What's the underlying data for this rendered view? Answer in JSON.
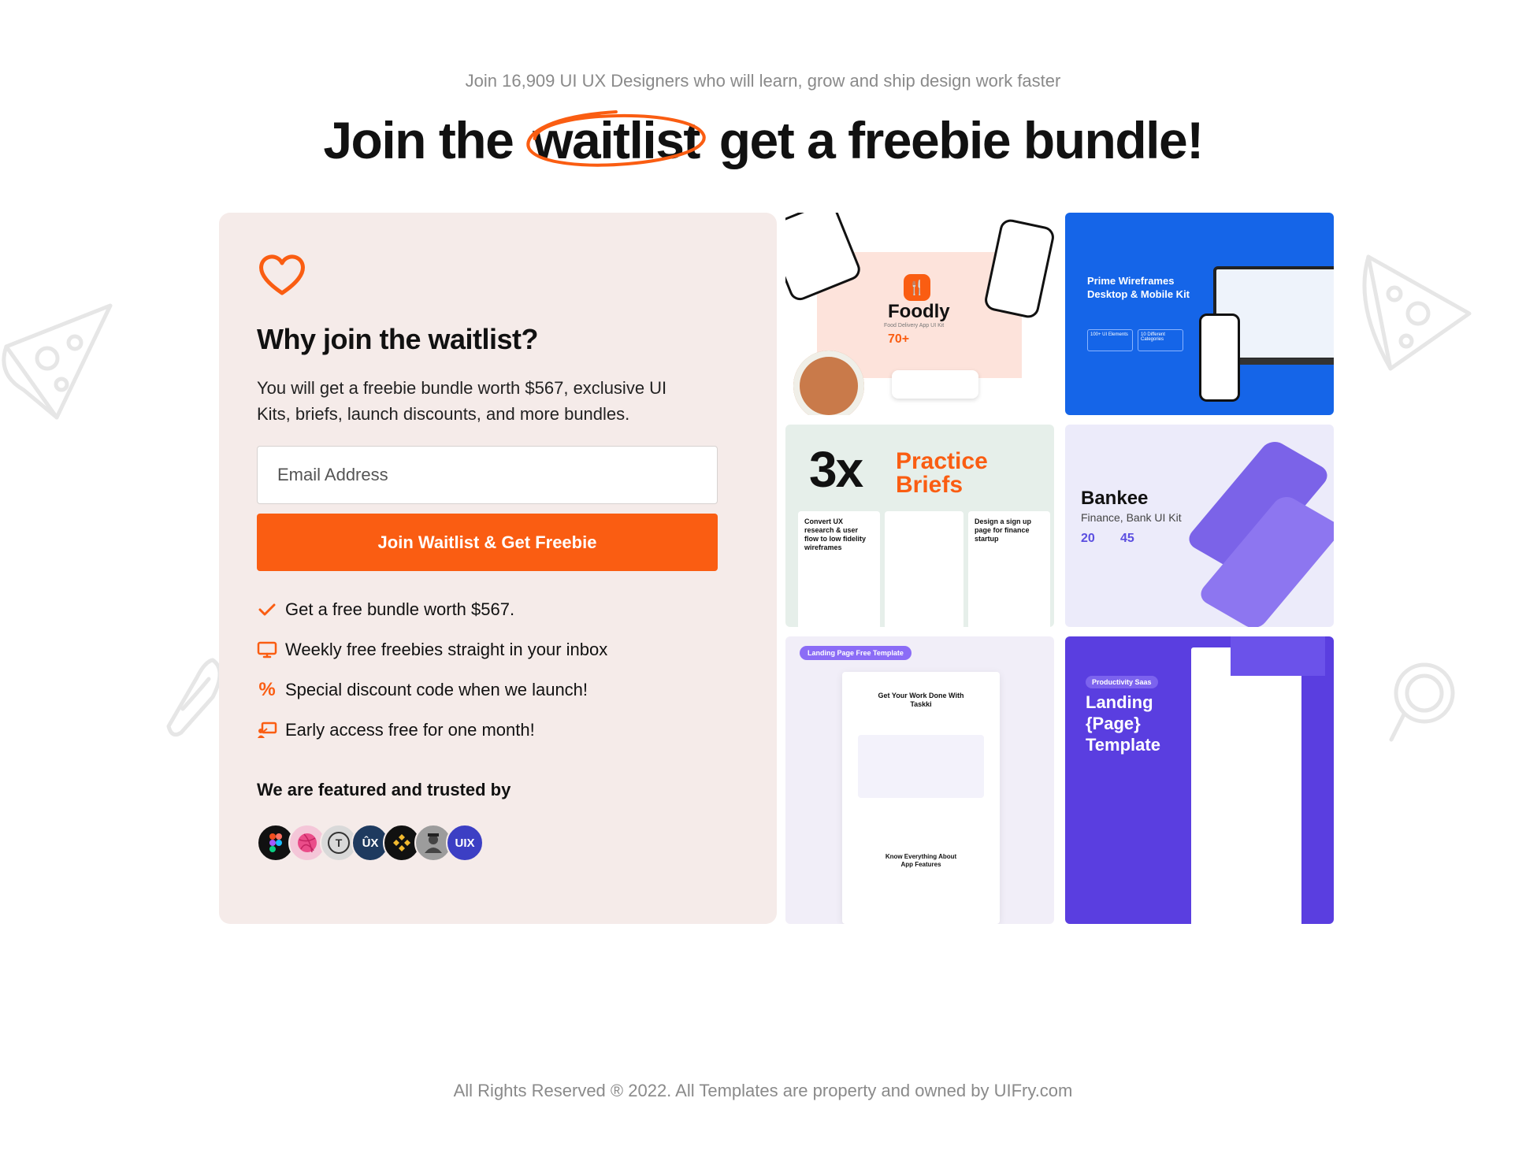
{
  "header": {
    "subtitle": "Join 16,909 UI UX Designers who will learn, grow and ship design work faster",
    "title_before": "Join the",
    "title_circled": "waitlist",
    "title_after": "get a freebie bundle!"
  },
  "card": {
    "title": "Why join the waitlist?",
    "description": "You will get a freebie bundle worth $567, exclusive UI Kits, briefs, launch discounts, and more bundles.",
    "email_placeholder": "Email Address",
    "cta_label": "Join Waitlist & Get Freebie",
    "benefits": [
      {
        "icon": "check-icon",
        "label": "Get a free bundle worth $567."
      },
      {
        "icon": "monitor-icon",
        "label": "Weekly free freebies straight in your inbox"
      },
      {
        "icon": "percent-icon",
        "label": "Special discount code when we launch!"
      },
      {
        "icon": "presentation-icon",
        "label": "Early access free for one month!"
      }
    ],
    "featured_label": "We are featured and trusted by",
    "featured_logos": [
      {
        "name": "figma-logo",
        "text": ""
      },
      {
        "name": "dribbble-logo",
        "text": ""
      },
      {
        "name": "t-logo",
        "text": "T"
      },
      {
        "name": "ux-logo",
        "text": "ÛX"
      },
      {
        "name": "binance-style-logo",
        "text": ""
      },
      {
        "name": "person-avatar-logo",
        "text": ""
      },
      {
        "name": "uix-logo",
        "text": "UIX"
      }
    ]
  },
  "gallery": {
    "foodly": {
      "title": "Foodly",
      "subtitle": "Food Delivery App UI Kit",
      "badge": "70+"
    },
    "wireframes": {
      "title": "Prime Wireframes Desktop & Mobile Kit",
      "stat1": "100+ UI Elements",
      "stat2": "10 Different Categories"
    },
    "briefs": {
      "big": "3x",
      "title_line1": "Practice",
      "title_line2": "Briefs",
      "brief1": "Convert UX research & user flow to low fidelity wireframes",
      "brief2": "Design a sign up page for finance startup"
    },
    "bankee": {
      "title": "Bankee",
      "subtitle": "Finance, Bank UI Kit",
      "stat1": "20",
      "stat2": "45"
    },
    "taskki": {
      "badge": "Landing Page Free Template",
      "headline": "Get Your Work Done With Taskki",
      "sub": "Know Everything About App Features"
    },
    "landing": {
      "badge": "Productivity Saas",
      "title": "Landing {Page} Template"
    }
  },
  "footer": {
    "text": "All Rights Reserved ® 2022. All Templates are property and owned by UIFry.com"
  },
  "colors": {
    "accent": "#fa5d12",
    "card_bg": "#f5ebe9",
    "muted_text": "#8a8a8a"
  }
}
